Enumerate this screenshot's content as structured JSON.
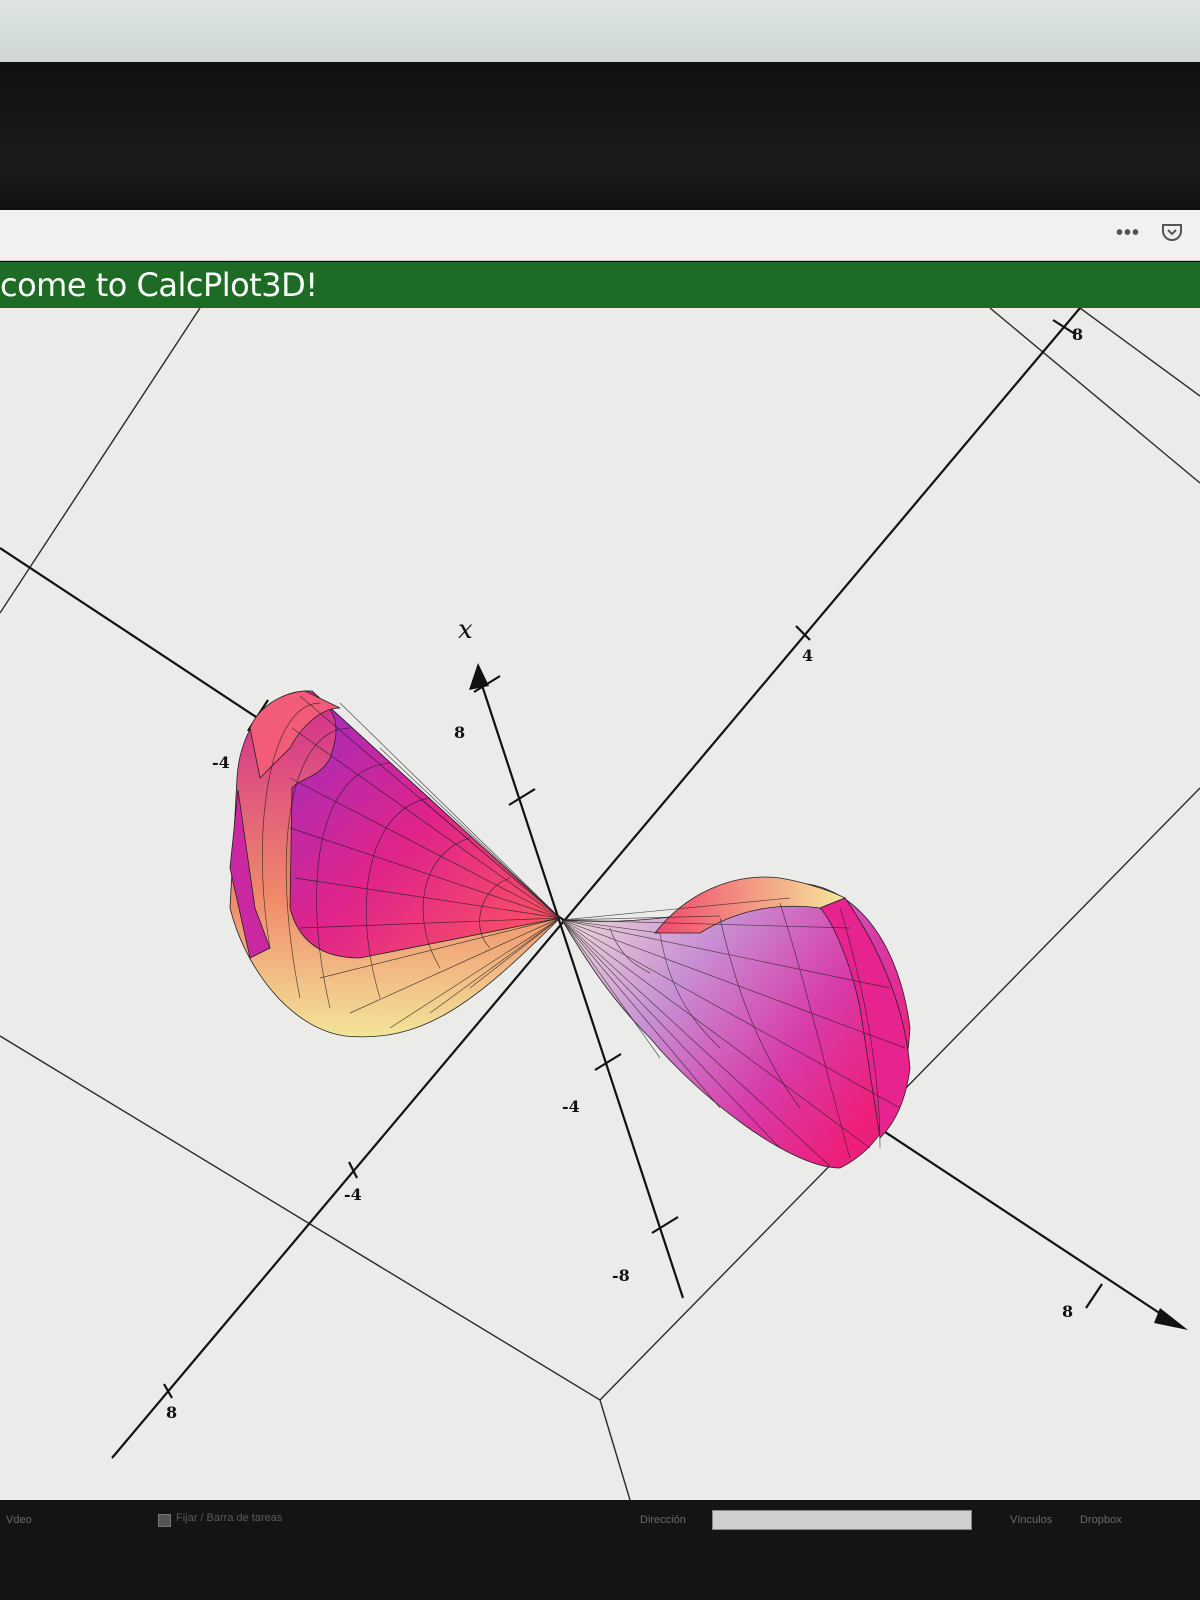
{
  "browser": {
    "more_icon": "more-icon",
    "more_glyph": "•••",
    "pocket_icon": "pocket-icon"
  },
  "app": {
    "title": "come to CalcPlot3D!",
    "bar_color": "#1e6b25"
  },
  "plot": {
    "background": "#ebebe9",
    "axis_letter": "x",
    "tick_labels": {
      "upper_right_8": "8",
      "upper_right_4": "4",
      "left_neg4": "-4",
      "x_8": "8",
      "x_neg4": "-4",
      "lower_left_neg4": "-4",
      "x_neg8": "-8",
      "lower_right_8": "8",
      "bottom_left_8": "8"
    },
    "surface_colors": [
      "#ff2f86",
      "#d4279a",
      "#b73fc8",
      "#f0a7a0",
      "#f4e89a"
    ]
  },
  "taskbar": {
    "status_left": "Vdeo",
    "checkbox_label": "Fijar / Barra de tareas",
    "direction_label": "Dirección",
    "direction_value": "",
    "links_label": "Vínculos",
    "dropbox_label": "Dropbox"
  }
}
